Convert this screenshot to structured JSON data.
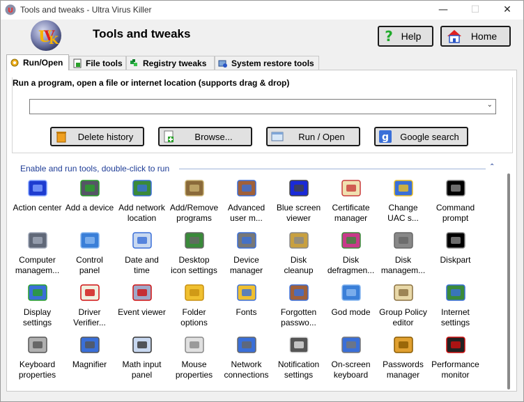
{
  "window": {
    "title": "Tools and tweaks - Ultra Virus Killer",
    "minimize": "—",
    "maximize": "☐",
    "close": "✕"
  },
  "header": {
    "title": "Tools and tweaks",
    "help_label": "Help",
    "home_label": "Home"
  },
  "tabs": [
    {
      "label": "Run/Open",
      "icon": "gear-icon"
    },
    {
      "label": "File tools",
      "icon": "file-add-icon"
    },
    {
      "label": "Registry tweaks",
      "icon": "registry-icon"
    },
    {
      "label": "System restore tools",
      "icon": "restore-icon"
    }
  ],
  "run": {
    "group_title": "Run a program, open a file or internet location (supports drag & drop)",
    "combo_value": "",
    "buttons": {
      "delete_history": "Delete history",
      "browse": "Browse...",
      "run_open": "Run / Open",
      "google_search": "Google search"
    }
  },
  "tools_section": {
    "header": "Enable and run tools, double-click to run",
    "items": [
      {
        "line1": "Action center",
        "line2": "",
        "icon": "flag-icon"
      },
      {
        "line1": "Add a device",
        "line2": "",
        "icon": "device-add-icon"
      },
      {
        "line1": "Add network",
        "line2": "location",
        "icon": "network-add-icon"
      },
      {
        "line1": "Add/Remove",
        "line2": "programs",
        "icon": "programs-icon"
      },
      {
        "line1": "Advanced",
        "line2": "user m...",
        "icon": "users-icon"
      },
      {
        "line1": "Blue screen",
        "line2": "viewer",
        "icon": "monitor-icon"
      },
      {
        "line1": "Certificate",
        "line2": "manager",
        "icon": "certificate-icon"
      },
      {
        "line1": "Change",
        "line2": "UAC s...",
        "icon": "shield-icon"
      },
      {
        "line1": "Command",
        "line2": "prompt",
        "icon": "console-icon"
      },
      {
        "line1": "Computer",
        "line2": "managem...",
        "icon": "computer-icon"
      },
      {
        "line1": "Control",
        "line2": "panel",
        "icon": "control-panel-icon"
      },
      {
        "line1": "Date and",
        "line2": "time",
        "icon": "calendar-icon"
      },
      {
        "line1": "Desktop",
        "line2": "icon settings",
        "icon": "desktop-icon"
      },
      {
        "line1": "Device",
        "line2": "manager",
        "icon": "device-manager-icon"
      },
      {
        "line1": "Disk",
        "line2": "cleanup",
        "icon": "disk-cleanup-icon"
      },
      {
        "line1": "Disk",
        "line2": "defragmen...",
        "icon": "defrag-icon"
      },
      {
        "line1": "Disk",
        "line2": "managem...",
        "icon": "disk-icon"
      },
      {
        "line1": "Diskpart",
        "line2": "",
        "icon": "console-icon"
      },
      {
        "line1": "Display",
        "line2": "settings",
        "icon": "display-icon"
      },
      {
        "line1": "Driver",
        "line2": "Verifier...",
        "icon": "checklist-icon"
      },
      {
        "line1": "Event viewer",
        "line2": "",
        "icon": "event-icon"
      },
      {
        "line1": "Folder",
        "line2": "options",
        "icon": "folder-icon"
      },
      {
        "line1": "Fonts",
        "line2": "",
        "icon": "font-icon"
      },
      {
        "line1": "Forgotten",
        "line2": "passwo...",
        "icon": "users-icon"
      },
      {
        "line1": "God mode",
        "line2": "",
        "icon": "control-panel-icon"
      },
      {
        "line1": "Group Policy",
        "line2": "editor",
        "icon": "scroll-icon"
      },
      {
        "line1": "Internet",
        "line2": "settings",
        "icon": "globe-icon"
      },
      {
        "line1": "Keyboard",
        "line2": "properties",
        "icon": "keyboard-icon"
      },
      {
        "line1": "Magnifier",
        "line2": "",
        "icon": "magnifier-icon"
      },
      {
        "line1": "Math input",
        "line2": "panel",
        "icon": "pen-icon"
      },
      {
        "line1": "Mouse",
        "line2": "properties",
        "icon": "mouse-icon"
      },
      {
        "line1": "Network",
        "line2": "connections",
        "icon": "network-icon"
      },
      {
        "line1": "Notification",
        "line2": "settings",
        "icon": "notification-icon"
      },
      {
        "line1": "On-screen",
        "line2": "keyboard",
        "icon": "onscreen-keyboard-icon"
      },
      {
        "line1": "Passwords",
        "line2": "manager",
        "icon": "key-icon"
      },
      {
        "line1": "Performance",
        "line2": "monitor",
        "icon": "gauge-icon"
      }
    ]
  }
}
